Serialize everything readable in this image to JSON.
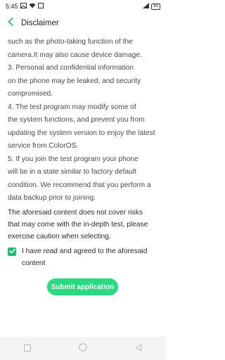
{
  "status": {
    "time": "5:45",
    "battery": "60"
  },
  "header": {
    "title": "Disclaimer"
  },
  "body_lines": [
    "such as the photo-taking function of the",
    "camera.It may also cause device damage.",
    "3. Personal and confidential information",
    "on the phone may be leaked, and security",
    "compromised.",
    "4. The test program may modify some of",
    "the system functions, and prevent you from",
    "updating the system version to enjoy the latest",
    "service from ColorOS.",
    "5. If you join the test program your phone",
    "will be in a state similar to factory default",
    "condition. We recommend that you perform a",
    "data backup prior to joining."
  ],
  "notice_lines": [
    "The aforesaid content does not cover risks",
    "that may come with the in-depth test, please",
    "exercise caution when selecting."
  ],
  "agree": {
    "checked": true,
    "lines": [
      "I have read and agreed to the aforesaid",
      "content"
    ]
  },
  "submit_label": "Submit application",
  "colors": {
    "accent": "#2bd97e",
    "checkbox": "#1fbf73"
  },
  "icons": {
    "back": "chevron-left-icon",
    "nav_recents": "square-icon",
    "nav_home": "circle-icon",
    "nav_back": "triangle-back-icon"
  }
}
